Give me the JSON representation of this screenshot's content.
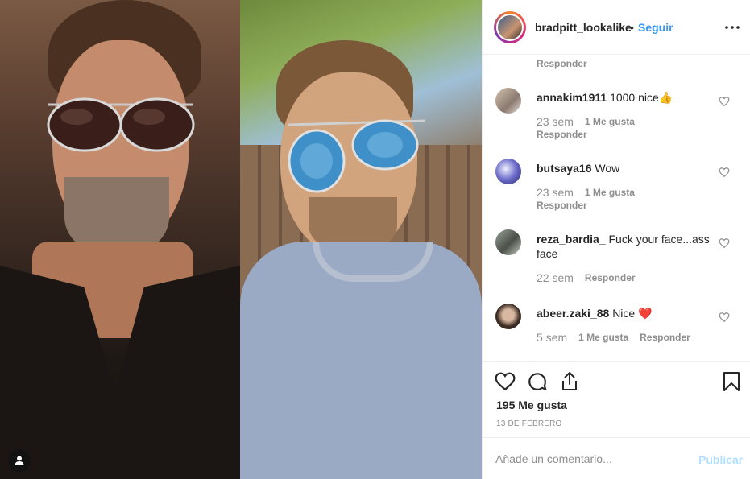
{
  "post": {
    "author": "bradpitt_lookalike",
    "separator": "•",
    "follow_label": "Seguir",
    "likes_text": "195 Me gusta",
    "date": "13 de febrero"
  },
  "comments": {
    "partial_reply_label": "Responder",
    "items": [
      {
        "user": "annakim1911",
        "text": "1000 nice👍",
        "time": "23 sem",
        "likes": "1 Me gusta",
        "reply": "Responder"
      },
      {
        "user": "butsaya16",
        "text": "Wow",
        "time": "23 sem",
        "likes": "1 Me gusta",
        "reply": "Responder"
      },
      {
        "user": "reza_bardia_",
        "text": "Fuck your face...ass face",
        "time": "22 sem",
        "reply": "Responder"
      },
      {
        "user": "abeer.zaki_88",
        "text": "Nice ❤️",
        "time": "5 sem",
        "likes": "1 Me gusta",
        "reply": "Responder"
      }
    ]
  },
  "composer": {
    "placeholder": "Añade un comentario...",
    "publish_label": "Publicar"
  },
  "icons": {
    "more": "more-options-icon",
    "heart": "heart-icon",
    "comment": "comment-icon",
    "share": "share-icon",
    "bookmark": "bookmark-icon",
    "user_tag": "user-tag-icon"
  },
  "colors": {
    "accent": "#3897f0",
    "publish_disabled": "#b2dffc",
    "muted": "#8e8e8e",
    "text": "#262626"
  }
}
